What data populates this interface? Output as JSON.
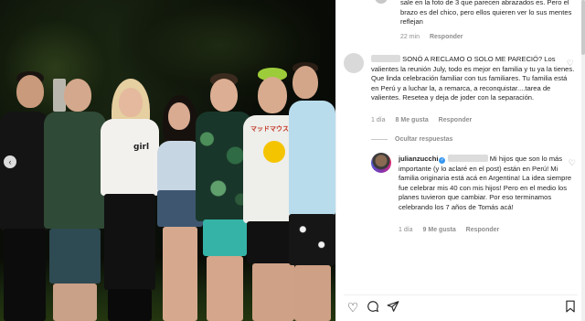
{
  "photo": {
    "alt_colors": {
      "background": "#050604",
      "foliage": "#1d2a14"
    },
    "shirt_print_1": "girl",
    "shirt_print_2": "マッドマウス",
    "nav_prev_icon": "chevron-left-icon"
  },
  "comments": [
    {
      "id": "c0",
      "text": "sale en la foto de 3 que parecen abrazados es. Pero el brazo es del chico, pero ellos quieren ver lo sus mentes reflejan",
      "time": "22 min",
      "reply": "Responder"
    },
    {
      "id": "c1",
      "username": "",
      "text": "SONÓ A RECLAMO O SOLO ME PARECIÓ? Los valientes la reunión July, todo es mejor en familia y tu ya la tienes. Que linda celebración familiar con tus familiares. Tu familia está en Perú y a luchar la, a remarca, a reconquistar....tarea de valientes. Resetea y deja de joder con la separación.",
      "time": "1 día",
      "likes": "8 Me gusta",
      "reply": "Responder",
      "hidden_replies": "Ocultar respuestas"
    },
    {
      "id": "c2",
      "username": "julianzucchi",
      "text": "Mi hijos que son lo más importante (y lo aclaré en el post) están en Perú! Mi familia originaria está acá en Argentina! La idea siempre fue celebrar mis 40 con mis hijos! Pero en el medio los planes tuvieron que cambiar. Por eso terminamos celebrando los 7 años de Tomás acá!",
      "time": "1 día",
      "likes": "9 Me gusta",
      "reply": "Responder"
    }
  ],
  "actions": {
    "like_icon": "heart-icon",
    "comment_icon": "comment-icon",
    "share_icon": "share-icon",
    "save_icon": "bookmark-icon"
  }
}
